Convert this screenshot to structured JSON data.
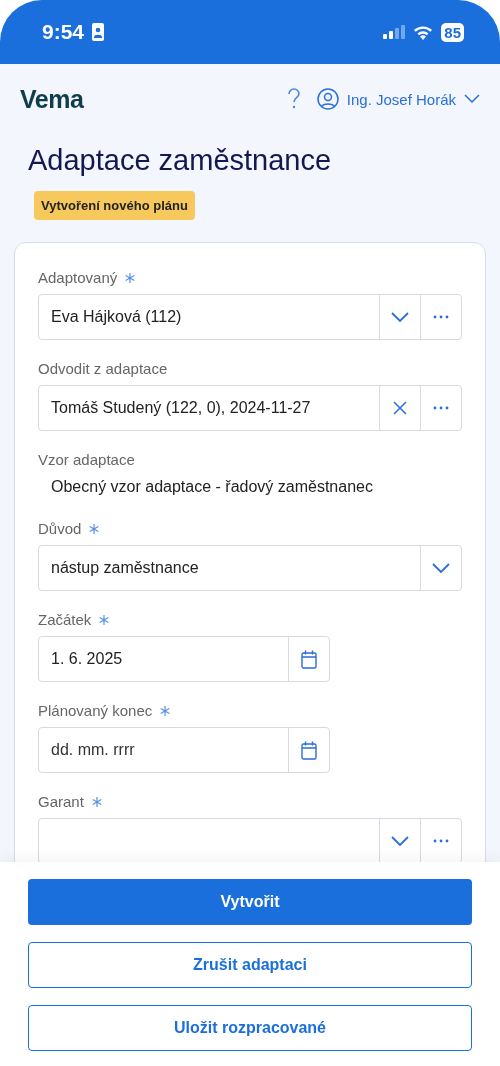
{
  "status_bar": {
    "time": "9:54",
    "battery": "85"
  },
  "header": {
    "logo": "Vema",
    "user": "Ing. Josef Horák"
  },
  "title": "Adaptace zaměstnance",
  "badge": "Vytvoření nového plánu",
  "fields": [
    {
      "kind": "picker",
      "label": "Adaptovaný",
      "required": true,
      "value": "Eva Hájková (112)"
    },
    {
      "kind": "derived",
      "label": "Odvodit z adaptace",
      "required": false,
      "value": "Tomáš Studený (122, 0), 2024-11-27"
    },
    {
      "kind": "static",
      "label": "Vzor adaptace",
      "required": false,
      "value": "Obecný vzor adaptace - řadový zaměstnanec"
    },
    {
      "kind": "select",
      "label": "Důvod",
      "required": true,
      "value": "nástup zaměstnance"
    },
    {
      "kind": "date",
      "label": "Začátek",
      "required": true,
      "value": "1. 6. 2025"
    },
    {
      "kind": "date",
      "label": "Plánovaný konec",
      "required": true,
      "placeholder": "dd. mm. rrrr"
    },
    {
      "kind": "picker",
      "label": "Garant",
      "required": true
    }
  ],
  "buttons": [
    {
      "label": "Vytvořit",
      "kind": "primary"
    },
    {
      "label": "Zrušit adaptaci",
      "kind": "outline"
    },
    {
      "label": "Uložit rozpracované",
      "kind": "outline"
    }
  ]
}
